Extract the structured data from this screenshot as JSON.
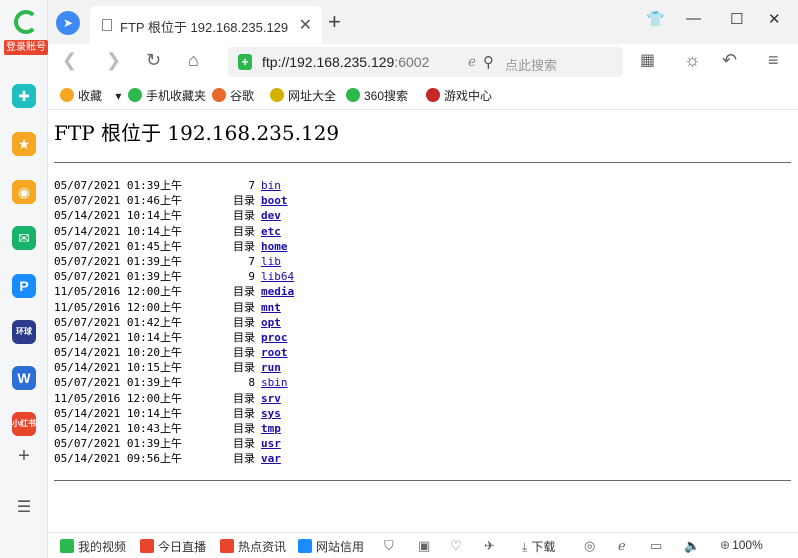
{
  "sidebar": {
    "login_label": "登录账号",
    "apps": [
      {
        "name": "plus-app",
        "glyph": "✚",
        "color": "#1fbfbf"
      },
      {
        "name": "favorites-app",
        "glyph": "★",
        "color": "#f5a623"
      },
      {
        "name": "weibo-app",
        "glyph": "◉",
        "color": "#f5a623"
      },
      {
        "name": "mail-app",
        "glyph": "✉",
        "color": "#19b26b"
      },
      {
        "name": "p-app",
        "glyph": "P",
        "color": "#1a8cff"
      },
      {
        "name": "news-app",
        "glyph": "环球",
        "color": "#2b3a8a"
      },
      {
        "name": "word-app",
        "glyph": "W",
        "color": "#2b6fd6"
      },
      {
        "name": "xiaohongshu-app",
        "glyph": "小红书",
        "color": "#e8452c"
      }
    ]
  },
  "tab": {
    "title": "FTP 根位于 192.168.235.129"
  },
  "address": {
    "url_main": "ftp://192.168.235.129",
    "url_port": ":6002"
  },
  "search": {
    "placeholder": "点此搜索"
  },
  "bookmarks": [
    {
      "label": "收藏",
      "icon": "star-icon",
      "color": "#f5a623"
    },
    {
      "label": "手机收藏夹",
      "icon": "phone-icon",
      "color": "#2db84d"
    },
    {
      "label": "谷歌",
      "icon": "google-icon",
      "color": "#e8692c"
    },
    {
      "label": "网址大全",
      "icon": "sitelist-icon",
      "color": "#d4b000"
    },
    {
      "label": "360搜索",
      "icon": "search-360-icon",
      "color": "#2db84d"
    },
    {
      "label": "游戏中心",
      "icon": "game-icon",
      "color": "#c62828"
    }
  ],
  "page": {
    "heading": "FTP 根位于 192.168.235.129"
  },
  "listing": [
    {
      "datetime": "05/07/2021 01:39上午",
      "type": "7",
      "name": "bin",
      "dir": false
    },
    {
      "datetime": "05/07/2021 01:46上午",
      "type": "目录",
      "name": "boot",
      "dir": true
    },
    {
      "datetime": "05/14/2021 10:14上午",
      "type": "目录",
      "name": "dev",
      "dir": true
    },
    {
      "datetime": "05/14/2021 10:14上午",
      "type": "目录",
      "name": "etc",
      "dir": true
    },
    {
      "datetime": "05/07/2021 01:45上午",
      "type": "目录",
      "name": "home",
      "dir": true
    },
    {
      "datetime": "05/07/2021 01:39上午",
      "type": "7",
      "name": "lib",
      "dir": false
    },
    {
      "datetime": "05/07/2021 01:39上午",
      "type": "9",
      "name": "lib64",
      "dir": false
    },
    {
      "datetime": "11/05/2016 12:00上午",
      "type": "目录",
      "name": "media",
      "dir": true
    },
    {
      "datetime": "11/05/2016 12:00上午",
      "type": "目录",
      "name": "mnt",
      "dir": true
    },
    {
      "datetime": "05/07/2021 01:42上午",
      "type": "目录",
      "name": "opt",
      "dir": true
    },
    {
      "datetime": "05/14/2021 10:14上午",
      "type": "目录",
      "name": "proc",
      "dir": true
    },
    {
      "datetime": "05/14/2021 10:20上午",
      "type": "目录",
      "name": "root",
      "dir": true
    },
    {
      "datetime": "05/14/2021 10:15上午",
      "type": "目录",
      "name": "run",
      "dir": true
    },
    {
      "datetime": "05/07/2021 01:39上午",
      "type": "8",
      "name": "sbin",
      "dir": false
    },
    {
      "datetime": "11/05/2016 12:00上午",
      "type": "目录",
      "name": "srv",
      "dir": true
    },
    {
      "datetime": "05/14/2021 10:14上午",
      "type": "目录",
      "name": "sys",
      "dir": true
    },
    {
      "datetime": "05/14/2021 10:43上午",
      "type": "目录",
      "name": "tmp",
      "dir": true
    },
    {
      "datetime": "05/07/2021 01:39上午",
      "type": "目录",
      "name": "usr",
      "dir": true
    },
    {
      "datetime": "05/14/2021 09:56上午",
      "type": "目录",
      "name": "var",
      "dir": true
    }
  ],
  "statusbar": {
    "items": [
      {
        "label": "我的视频",
        "icon": "video-icon",
        "color": "#2db84d"
      },
      {
        "label": "今日直播",
        "icon": "fire-icon",
        "color": "#e8452c"
      },
      {
        "label": "热点资讯",
        "icon": "news-icon",
        "color": "#e8452c"
      },
      {
        "label": "网站信用",
        "icon": "credit-icon",
        "color": "#1a8cff"
      }
    ],
    "download_label": "下载",
    "zoom": "100%"
  }
}
